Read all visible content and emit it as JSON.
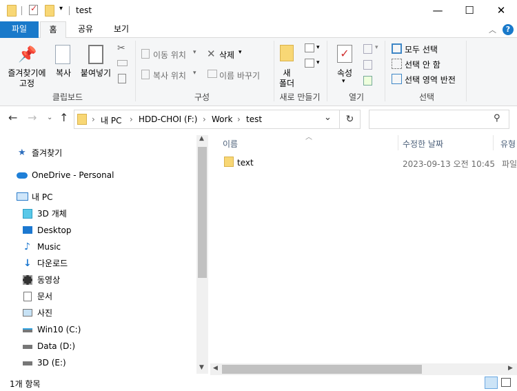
{
  "window": {
    "title": "test",
    "minimize": "—",
    "maximize": "☐",
    "close": "✕"
  },
  "tabs": {
    "file": "파일",
    "home": "홈",
    "share": "공유",
    "view": "보기"
  },
  "ribbon": {
    "pin_label_1": "즐겨찾기에",
    "pin_label_2": "고정",
    "copy": "복사",
    "paste": "붙여넣기",
    "clipboard_group": "클립보드",
    "move_to": "이동 위치",
    "copy_to": "복사 위치",
    "delete": "삭제",
    "rename": "이름 바꾸기",
    "organize_group": "구성",
    "new_folder_1": "새",
    "new_folder_2": "폴더",
    "new_group": "새로 만들기",
    "properties": "속성",
    "open_group": "열기",
    "select_all": "모두 선택",
    "select_none": "선택 안 함",
    "invert_selection": "선택 영역 반전",
    "select_group": "선택"
  },
  "address": {
    "crumbs": [
      "내 PC",
      "HDD-CHOI (F:)",
      "Work",
      "test"
    ]
  },
  "nav": {
    "quick_access": "즐겨찾기",
    "onedrive": "OneDrive - Personal",
    "this_pc": "내 PC",
    "items": [
      "3D 개체",
      "Desktop",
      "Music",
      "다운로드",
      "동영상",
      "문서",
      "사진",
      "Win10 (C:)",
      "Data (D:)",
      "3D (E:)"
    ]
  },
  "columns": {
    "name": "이름",
    "modified": "수정한 날짜",
    "type": "유형"
  },
  "files": [
    {
      "name": "text",
      "modified": "2023-09-13 오전 10:45",
      "type": "파일"
    }
  ],
  "status": {
    "count": "1개 항목"
  },
  "colors": {
    "file_tab": "#1979ca",
    "folder": "#f8d775",
    "header_text": "#4c607a"
  }
}
